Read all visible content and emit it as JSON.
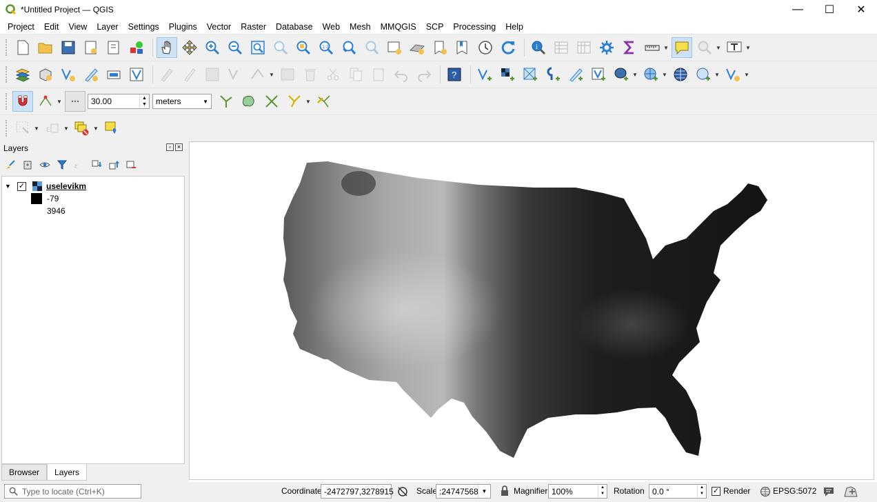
{
  "window": {
    "title": "*Untitled Project — QGIS",
    "minimize": "—",
    "maximize": "☐",
    "close": "✕"
  },
  "menu": [
    "Project",
    "Edit",
    "View",
    "Layer",
    "Settings",
    "Plugins",
    "Vector",
    "Raster",
    "Database",
    "Web",
    "Mesh",
    "MMQGIS",
    "SCP",
    "Processing",
    "Help"
  ],
  "snapping": {
    "tolerance": "30.00",
    "units": "meters"
  },
  "layers_panel": {
    "title": "Layers",
    "layer_name": "uselevikm",
    "legend_min": "-79",
    "legend_max": "3946"
  },
  "tabs": [
    "Browser",
    "Layers"
  ],
  "status": {
    "locate_placeholder": "Type to locate (Ctrl+K)",
    "coordinate_label": "Coordinate",
    "coordinate_value": "-2472797,3278915",
    "scale_label": "Scale",
    "scale_value": ":24747568",
    "magnifier_label": "Magnifier",
    "magnifier_value": "100%",
    "rotation_label": "Rotation",
    "rotation_value": "0.0 °",
    "render_label": "Render",
    "crs": "EPSG:5072"
  },
  "colors": {
    "qgis_green": "#589632",
    "accent_blue": "#2a7fd4",
    "toolbar_bg": "#f0f0f0"
  }
}
